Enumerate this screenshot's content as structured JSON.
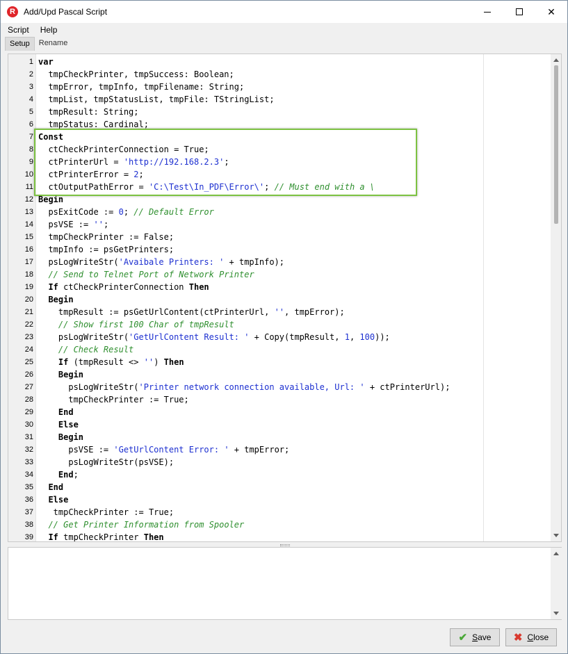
{
  "window": {
    "title": "Add/Upd Pascal Script",
    "app_icon": "R",
    "minimize_icon": "minimize-icon",
    "maximize_icon": "maximize-icon",
    "close_icon": "close-icon",
    "close_glyph": "✕"
  },
  "menu": {
    "items": [
      "Script",
      "Help"
    ]
  },
  "tabs": {
    "items": [
      "Setup",
      "Rename"
    ],
    "active": "Setup"
  },
  "editor": {
    "highlight_color": "#7dc242",
    "lines": [
      {
        "n": "1",
        "parts": [
          [
            "kw",
            "var"
          ]
        ]
      },
      {
        "n": "2",
        "parts": [
          [
            "t",
            "  tmpCheckPrinter, tmpSuccess: Boolean;"
          ]
        ]
      },
      {
        "n": "3",
        "parts": [
          [
            "t",
            "  tmpError, tmpInfo, tmpFilename: String;"
          ]
        ]
      },
      {
        "n": "4",
        "parts": [
          [
            "t",
            "  tmpList, tmpStatusList, tmpFile: TStringList;"
          ]
        ]
      },
      {
        "n": "5",
        "parts": [
          [
            "t",
            "  tmpResult: String;"
          ]
        ]
      },
      {
        "n": "6",
        "parts": [
          [
            "t",
            "  tmpStatus: Cardinal;"
          ]
        ]
      },
      {
        "n": "7",
        "parts": [
          [
            "kw",
            "Const"
          ]
        ]
      },
      {
        "n": "8",
        "parts": [
          [
            "t",
            "  ctCheckPrinterConnection = True;"
          ]
        ]
      },
      {
        "n": "9",
        "parts": [
          [
            "t",
            "  ctPrinterUrl = "
          ],
          [
            "str",
            "'http://192.168.2.3'"
          ],
          [
            "t",
            ";"
          ]
        ]
      },
      {
        "n": "10",
        "parts": [
          [
            "t",
            "  ctPrinterError = "
          ],
          [
            "num",
            "2"
          ],
          [
            "t",
            ";"
          ]
        ]
      },
      {
        "n": "11",
        "parts": [
          [
            "t",
            "  ctOutputPathError = "
          ],
          [
            "str",
            "'C:\\Test\\In_PDF\\Error\\'"
          ],
          [
            "t",
            "; "
          ],
          [
            "cmt",
            "// Must end with a \\"
          ]
        ]
      },
      {
        "n": "12",
        "parts": [
          [
            "kw",
            "Begin"
          ]
        ]
      },
      {
        "n": "13",
        "parts": [
          [
            "t",
            "  psExitCode := "
          ],
          [
            "num",
            "0"
          ],
          [
            "t",
            "; "
          ],
          [
            "cmt",
            "// Default Error"
          ]
        ]
      },
      {
        "n": "14",
        "parts": [
          [
            "t",
            "  psVSE := "
          ],
          [
            "str",
            "''"
          ],
          [
            "t",
            ";"
          ]
        ]
      },
      {
        "n": "15",
        "parts": [
          [
            "t",
            "  tmpCheckPrinter := False;"
          ]
        ]
      },
      {
        "n": "16",
        "parts": [
          [
            "t",
            "  tmpInfo := psGetPrinters;"
          ]
        ]
      },
      {
        "n": "17",
        "parts": [
          [
            "t",
            "  psLogWriteStr("
          ],
          [
            "str",
            "'Avaibale Printers: '"
          ],
          [
            "t",
            " + tmpInfo);"
          ]
        ]
      },
      {
        "n": "18",
        "parts": [
          [
            "t",
            "  "
          ],
          [
            "cmt",
            "// Send to Telnet Port of Network Printer"
          ]
        ]
      },
      {
        "n": "19",
        "parts": [
          [
            "t",
            "  "
          ],
          [
            "kw",
            "If"
          ],
          [
            "t",
            " ctCheckPrinterConnection "
          ],
          [
            "kw",
            "Then"
          ]
        ]
      },
      {
        "n": "20",
        "parts": [
          [
            "t",
            "  "
          ],
          [
            "kw",
            "Begin"
          ]
        ]
      },
      {
        "n": "21",
        "parts": [
          [
            "t",
            "    tmpResult := psGetUrlContent(ctPrinterUrl, "
          ],
          [
            "str",
            "''"
          ],
          [
            "t",
            ", tmpError);"
          ]
        ]
      },
      {
        "n": "22",
        "parts": [
          [
            "t",
            "    "
          ],
          [
            "cmt",
            "// Show first 100 Char of tmpResult"
          ]
        ]
      },
      {
        "n": "23",
        "parts": [
          [
            "t",
            "    psLogWriteStr("
          ],
          [
            "str",
            "'GetUrlContent Result: '"
          ],
          [
            "t",
            " + Copy(tmpResult, "
          ],
          [
            "num",
            "1"
          ],
          [
            "t",
            ", "
          ],
          [
            "num",
            "100"
          ],
          [
            "t",
            "));"
          ]
        ]
      },
      {
        "n": "24",
        "parts": [
          [
            "t",
            "    "
          ],
          [
            "cmt",
            "// Check Result"
          ]
        ]
      },
      {
        "n": "25",
        "parts": [
          [
            "t",
            "    "
          ],
          [
            "kw",
            "If"
          ],
          [
            "t",
            " (tmpResult <> "
          ],
          [
            "str",
            "''"
          ],
          [
            "t",
            ") "
          ],
          [
            "kw",
            "Then"
          ]
        ]
      },
      {
        "n": "26",
        "parts": [
          [
            "t",
            "    "
          ],
          [
            "kw",
            "Begin"
          ]
        ]
      },
      {
        "n": "27",
        "parts": [
          [
            "t",
            "      psLogWriteStr("
          ],
          [
            "str",
            "'Printer network connection available, Url: '"
          ],
          [
            "t",
            " + ctPrinterUrl);"
          ]
        ]
      },
      {
        "n": "28",
        "parts": [
          [
            "t",
            "      tmpCheckPrinter := True;"
          ]
        ]
      },
      {
        "n": "29",
        "parts": [
          [
            "t",
            "    "
          ],
          [
            "kw",
            "End"
          ]
        ]
      },
      {
        "n": "30",
        "parts": [
          [
            "t",
            "    "
          ],
          [
            "kw",
            "Else"
          ]
        ]
      },
      {
        "n": "31",
        "parts": [
          [
            "t",
            "    "
          ],
          [
            "kw",
            "Begin"
          ]
        ]
      },
      {
        "n": "32",
        "parts": [
          [
            "t",
            "      psVSE := "
          ],
          [
            "str",
            "'GetUrlContent Error: '"
          ],
          [
            "t",
            " + tmpError;"
          ]
        ]
      },
      {
        "n": "33",
        "parts": [
          [
            "t",
            "      psLogWriteStr(psVSE);"
          ]
        ]
      },
      {
        "n": "34",
        "parts": [
          [
            "t",
            "    "
          ],
          [
            "kw",
            "End"
          ],
          [
            "t",
            ";"
          ]
        ]
      },
      {
        "n": "35",
        "parts": [
          [
            "t",
            "  "
          ],
          [
            "kw",
            "End"
          ]
        ]
      },
      {
        "n": "36",
        "parts": [
          [
            "t",
            "  "
          ],
          [
            "kw",
            "Else"
          ]
        ]
      },
      {
        "n": "37",
        "parts": [
          [
            "t",
            "   tmpCheckPrinter := True;"
          ]
        ]
      },
      {
        "n": "38",
        "parts": [
          [
            "t",
            "  "
          ],
          [
            "cmt",
            "// Get Printer Information from Spooler"
          ]
        ]
      },
      {
        "n": "39",
        "parts": [
          [
            "t",
            "  "
          ],
          [
            "kw",
            "If"
          ],
          [
            "t",
            " tmpCheckPrinter "
          ],
          [
            "kw",
            "Then"
          ]
        ]
      }
    ]
  },
  "buttons": {
    "save": {
      "accel": "S",
      "rest": "ave",
      "icon": "check-icon"
    },
    "close": {
      "accel": "C",
      "rest": "lose",
      "icon": "cross-icon"
    }
  }
}
